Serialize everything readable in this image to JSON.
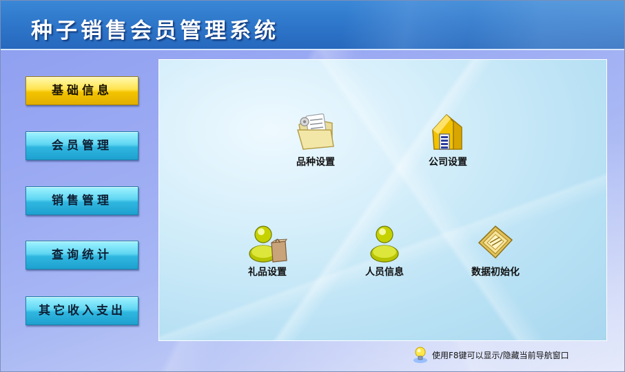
{
  "header": {
    "title": "种子销售会员管理系统"
  },
  "nav": {
    "items": [
      {
        "label": "基础信息",
        "active": true
      },
      {
        "label": "会员管理",
        "active": false
      },
      {
        "label": "销售管理",
        "active": false
      },
      {
        "label": "查询统计",
        "active": false
      },
      {
        "label": "其它收入支出",
        "active": false
      }
    ]
  },
  "panel": {
    "tiles": [
      {
        "label": "品种设置",
        "icon": "folder-document-icon"
      },
      {
        "label": "公司设置",
        "icon": "house-icon"
      },
      {
        "label": "礼品设置",
        "icon": "user-shopping-bag-icon"
      },
      {
        "label": "人员信息",
        "icon": "user-icon"
      },
      {
        "label": "数据初始化",
        "icon": "data-folder-icon"
      }
    ]
  },
  "status": {
    "hint": "使用F8键可以显示/隐藏当前导航窗口",
    "icon": "lightbulb-icon"
  },
  "colors": {
    "header": "#2f78cb",
    "nav_button": "#2fb7e0",
    "nav_button_active": "#f3c400",
    "panel": "#c8e8f6"
  }
}
